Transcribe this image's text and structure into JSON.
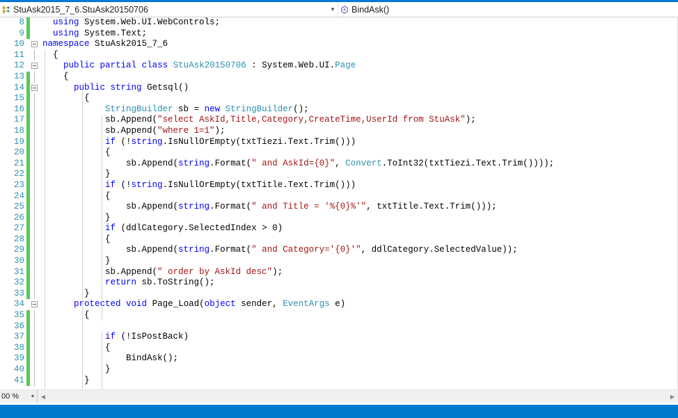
{
  "window": {
    "accent_color": "#0078d7",
    "statusbar_color": "#007acc"
  },
  "navbar": {
    "type_combo": {
      "icon": "class-icon",
      "value": "StuAsk2015_7_6.StuAsk20150706",
      "arrow": "chevron-down-icon"
    },
    "member_combo": {
      "icon": "method-icon",
      "value": "BindAsk()",
      "arrow": "chevron-down-icon"
    }
  },
  "editor": {
    "language": "csharp",
    "first_visible_line": 8,
    "colors": {
      "keyword": "#0000ff",
      "type": "#2b91af",
      "string": "#a31515",
      "plain": "#000000",
      "line_number": "#2b91af",
      "saved_change_bar": "#57c957",
      "background": "#ffffff"
    },
    "lines": [
      {
        "num": "8",
        "changed": true,
        "fold": "none",
        "guide": "stub",
        "tokens": [
          {
            "t": "  ",
            "c": "pl"
          },
          {
            "t": "using",
            "c": "kw"
          },
          {
            "t": " System.Web.UI.WebControls;",
            "c": "pl"
          }
        ]
      },
      {
        "num": "9",
        "changed": true,
        "fold": "none",
        "guide": "stub",
        "tokens": [
          {
            "t": "  ",
            "c": "pl"
          },
          {
            "t": "using",
            "c": "kw"
          },
          {
            "t": " System.Text;",
            "c": "pl"
          }
        ]
      },
      {
        "num": "10",
        "changed": false,
        "fold": "minus",
        "guide": "none",
        "tokens": [
          {
            "t": "namespace",
            "c": "kw"
          },
          {
            "t": " StuAsk2015_7_6",
            "c": "pl"
          }
        ]
      },
      {
        "num": "11",
        "changed": false,
        "fold": "line",
        "guide": "none",
        "tokens": [
          {
            "t": "  {",
            "c": "pl"
          }
        ]
      },
      {
        "num": "12",
        "changed": false,
        "fold": "minus",
        "guide": "none",
        "tokens": [
          {
            "t": "    ",
            "c": "pl"
          },
          {
            "t": "public",
            "c": "kw"
          },
          {
            "t": " ",
            "c": "pl"
          },
          {
            "t": "partial",
            "c": "kw"
          },
          {
            "t": " ",
            "c": "pl"
          },
          {
            "t": "class",
            "c": "kw"
          },
          {
            "t": " ",
            "c": "pl"
          },
          {
            "t": "StuAsk20150706",
            "c": "ty"
          },
          {
            "t": " : System.Web.UI.",
            "c": "pl"
          },
          {
            "t": "Page",
            "c": "ty"
          }
        ]
      },
      {
        "num": "13",
        "changed": true,
        "fold": "line",
        "guide": "none",
        "tokens": [
          {
            "t": "    {",
            "c": "pl"
          }
        ]
      },
      {
        "num": "14",
        "changed": true,
        "fold": "minus",
        "guide": "none",
        "tokens": [
          {
            "t": "      ",
            "c": "pl"
          },
          {
            "t": "public",
            "c": "kw"
          },
          {
            "t": " ",
            "c": "pl"
          },
          {
            "t": "string",
            "c": "kw"
          },
          {
            "t": " Getsql()",
            "c": "pl"
          }
        ]
      },
      {
        "num": "15",
        "changed": true,
        "fold": "line",
        "guide": "none",
        "tokens": [
          {
            "t": "        {",
            "c": "pl"
          }
        ]
      },
      {
        "num": "16",
        "changed": true,
        "fold": "line",
        "guide": "none",
        "tokens": [
          {
            "t": "            ",
            "c": "pl"
          },
          {
            "t": "StringBuilder",
            "c": "ty"
          },
          {
            "t": " sb = ",
            "c": "pl"
          },
          {
            "t": "new",
            "c": "kw"
          },
          {
            "t": " ",
            "c": "pl"
          },
          {
            "t": "StringBuilder",
            "c": "ty"
          },
          {
            "t": "();",
            "c": "pl"
          }
        ]
      },
      {
        "num": "17",
        "changed": true,
        "fold": "line",
        "guide": "none",
        "tokens": [
          {
            "t": "            sb.Append(",
            "c": "pl"
          },
          {
            "t": "\"select AskId,Title,Category,CreateTime,UserId from StuAsk\"",
            "c": "str"
          },
          {
            "t": ");",
            "c": "pl"
          }
        ]
      },
      {
        "num": "18",
        "changed": true,
        "fold": "line",
        "guide": "none",
        "tokens": [
          {
            "t": "            sb.Append(",
            "c": "pl"
          },
          {
            "t": "\"where 1=1\"",
            "c": "str"
          },
          {
            "t": ");",
            "c": "pl"
          }
        ]
      },
      {
        "num": "19",
        "changed": true,
        "fold": "line",
        "guide": "none",
        "tokens": [
          {
            "t": "            ",
            "c": "pl"
          },
          {
            "t": "if",
            "c": "kw"
          },
          {
            "t": " (!",
            "c": "pl"
          },
          {
            "t": "string",
            "c": "kw"
          },
          {
            "t": ".IsNullOrEmpty(txtTiezi.Text.Trim()))",
            "c": "pl"
          }
        ]
      },
      {
        "num": "20",
        "changed": true,
        "fold": "line",
        "guide": "none",
        "tokens": [
          {
            "t": "            {",
            "c": "pl"
          }
        ]
      },
      {
        "num": "21",
        "changed": true,
        "fold": "line",
        "guide": "none",
        "tokens": [
          {
            "t": "                sb.Append(",
            "c": "pl"
          },
          {
            "t": "string",
            "c": "kw"
          },
          {
            "t": ".Format(",
            "c": "pl"
          },
          {
            "t": "\" and AskId={0}\"",
            "c": "str"
          },
          {
            "t": ", ",
            "c": "pl"
          },
          {
            "t": "Convert",
            "c": "ty"
          },
          {
            "t": ".ToInt32(txtTiezi.Text.Trim())));",
            "c": "pl"
          }
        ]
      },
      {
        "num": "22",
        "changed": true,
        "fold": "line",
        "guide": "none",
        "tokens": [
          {
            "t": "            }",
            "c": "pl"
          }
        ]
      },
      {
        "num": "23",
        "changed": true,
        "fold": "line",
        "guide": "none",
        "tokens": [
          {
            "t": "            ",
            "c": "pl"
          },
          {
            "t": "if",
            "c": "kw"
          },
          {
            "t": " (!",
            "c": "pl"
          },
          {
            "t": "string",
            "c": "kw"
          },
          {
            "t": ".IsNullOrEmpty(txtTitle.Text.Trim()))",
            "c": "pl"
          }
        ]
      },
      {
        "num": "24",
        "changed": true,
        "fold": "line",
        "guide": "none",
        "tokens": [
          {
            "t": "            {",
            "c": "pl"
          }
        ]
      },
      {
        "num": "25",
        "changed": true,
        "fold": "line",
        "guide": "none",
        "tokens": [
          {
            "t": "                sb.Append(",
            "c": "pl"
          },
          {
            "t": "string",
            "c": "kw"
          },
          {
            "t": ".Format(",
            "c": "pl"
          },
          {
            "t": "\" and Title = '%{0}%'\"",
            "c": "str"
          },
          {
            "t": ", txtTitle.Text.Trim()));",
            "c": "pl"
          }
        ]
      },
      {
        "num": "26",
        "changed": true,
        "fold": "line",
        "guide": "none",
        "tokens": [
          {
            "t": "            }",
            "c": "pl"
          }
        ]
      },
      {
        "num": "27",
        "changed": true,
        "fold": "line",
        "guide": "none",
        "tokens": [
          {
            "t": "            ",
            "c": "pl"
          },
          {
            "t": "if",
            "c": "kw"
          },
          {
            "t": " (ddlCategory.SelectedIndex > 0)",
            "c": "pl"
          }
        ]
      },
      {
        "num": "28",
        "changed": true,
        "fold": "line",
        "guide": "none",
        "tokens": [
          {
            "t": "            {",
            "c": "pl"
          }
        ]
      },
      {
        "num": "29",
        "changed": true,
        "fold": "line",
        "guide": "none",
        "tokens": [
          {
            "t": "                sb.Append(",
            "c": "pl"
          },
          {
            "t": "string",
            "c": "kw"
          },
          {
            "t": ".Format(",
            "c": "pl"
          },
          {
            "t": "\" and Category='{0}'\"",
            "c": "str"
          },
          {
            "t": ", ddlCategory.SelectedValue));",
            "c": "pl"
          }
        ]
      },
      {
        "num": "30",
        "changed": true,
        "fold": "line",
        "guide": "none",
        "tokens": [
          {
            "t": "            }",
            "c": "pl"
          }
        ]
      },
      {
        "num": "31",
        "changed": true,
        "fold": "line",
        "guide": "none",
        "tokens": [
          {
            "t": "            sb.Append(",
            "c": "pl"
          },
          {
            "t": "\" order by AskId desc\"",
            "c": "str"
          },
          {
            "t": ");",
            "c": "pl"
          }
        ]
      },
      {
        "num": "32",
        "changed": true,
        "fold": "line",
        "guide": "none",
        "tokens": [
          {
            "t": "            ",
            "c": "pl"
          },
          {
            "t": "return",
            "c": "kw"
          },
          {
            "t": " sb.ToString();",
            "c": "pl"
          }
        ]
      },
      {
        "num": "33",
        "changed": true,
        "fold": "line",
        "guide": "none",
        "tokens": [
          {
            "t": "        }",
            "c": "pl"
          }
        ]
      },
      {
        "num": "34",
        "changed": false,
        "fold": "minus",
        "guide": "none",
        "tokens": [
          {
            "t": "      ",
            "c": "pl"
          },
          {
            "t": "protected",
            "c": "kw"
          },
          {
            "t": " ",
            "c": "pl"
          },
          {
            "t": "void",
            "c": "kw"
          },
          {
            "t": " Page_Load(",
            "c": "pl"
          },
          {
            "t": "object",
            "c": "kw"
          },
          {
            "t": " sender, ",
            "c": "pl"
          },
          {
            "t": "EventArgs",
            "c": "ty"
          },
          {
            "t": " e)",
            "c": "pl"
          }
        ]
      },
      {
        "num": "35",
        "changed": true,
        "fold": "line",
        "guide": "none",
        "tokens": [
          {
            "t": "        {",
            "c": "pl"
          }
        ]
      },
      {
        "num": "36",
        "changed": true,
        "fold": "line",
        "guide": "none",
        "tokens": [
          {
            "t": "",
            "c": "pl"
          }
        ]
      },
      {
        "num": "37",
        "changed": true,
        "fold": "line",
        "guide": "none",
        "tokens": [
          {
            "t": "            ",
            "c": "pl"
          },
          {
            "t": "if",
            "c": "kw"
          },
          {
            "t": " (!IsPostBack)",
            "c": "pl"
          }
        ]
      },
      {
        "num": "38",
        "changed": true,
        "fold": "line",
        "guide": "none",
        "tokens": [
          {
            "t": "            {",
            "c": "pl"
          }
        ]
      },
      {
        "num": "39",
        "changed": true,
        "fold": "line",
        "guide": "none",
        "tokens": [
          {
            "t": "                BindAsk();",
            "c": "pl"
          }
        ]
      },
      {
        "num": "40",
        "changed": true,
        "fold": "line",
        "guide": "none",
        "tokens": [
          {
            "t": "            }",
            "c": "pl"
          }
        ]
      },
      {
        "num": "41",
        "changed": true,
        "fold": "line",
        "guide": "none",
        "tokens": [
          {
            "t": "        }",
            "c": "pl"
          }
        ]
      }
    ]
  },
  "bottom": {
    "zoom_value": "00 %",
    "zoom_arrow": "chevron-down-icon",
    "scroll_left": "triangle-left-icon",
    "scroll_right": "triangle-right-icon"
  }
}
